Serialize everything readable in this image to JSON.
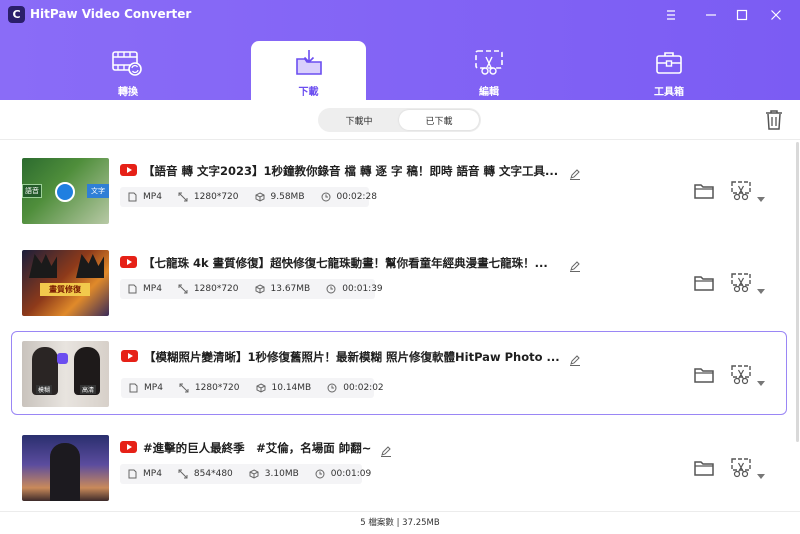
{
  "app": {
    "title": "HitPaw Video Converter",
    "logo_letter": "C"
  },
  "tabs": [
    {
      "label": "轉換"
    },
    {
      "label": "下載"
    },
    {
      "label": "編輯"
    },
    {
      "label": "工具箱"
    }
  ],
  "segment": {
    "downloading": "下載中",
    "downloaded": "已下載"
  },
  "items": [
    {
      "title": "【語音 轉 文字2023】1秒鐘教你錄音 檔 轉 逐 字 稿！即時 語音 轉 文字工具...",
      "format": "MP4",
      "resolution": "1280*720",
      "size": "9.58MB",
      "duration": "00:02:28",
      "thumb_text_a": "語音",
      "thumb_text_b": "文字"
    },
    {
      "title": "【七龍珠 4k 畫質修復】超快修復七龍珠動畫！幫你看童年經典漫畫七龍珠！...",
      "format": "MP4",
      "resolution": "1280*720",
      "size": "13.67MB",
      "duration": "00:01:39",
      "thumb_text_a": "畫質修復"
    },
    {
      "title": "【模糊照片變清晰】1秒修復舊照片！最新模糊 照片修復軟體HitPaw Photo ...",
      "format": "MP4",
      "resolution": "1280*720",
      "size": "10.14MB",
      "duration": "00:02:02",
      "thumb_text_a": "模糊",
      "thumb_text_b": "高清"
    },
    {
      "title": "#進擊的巨人最終季　#艾倫，名場面 帥翻~",
      "format": "MP4",
      "resolution": "854*480",
      "size": "3.10MB",
      "duration": "00:01:09"
    }
  ],
  "footer": {
    "summary": "5 檔案數 | 37.25MB"
  },
  "colors": {
    "header": "#7f62f5",
    "accent": "#6b4ef0",
    "youtube": "#e62117"
  }
}
